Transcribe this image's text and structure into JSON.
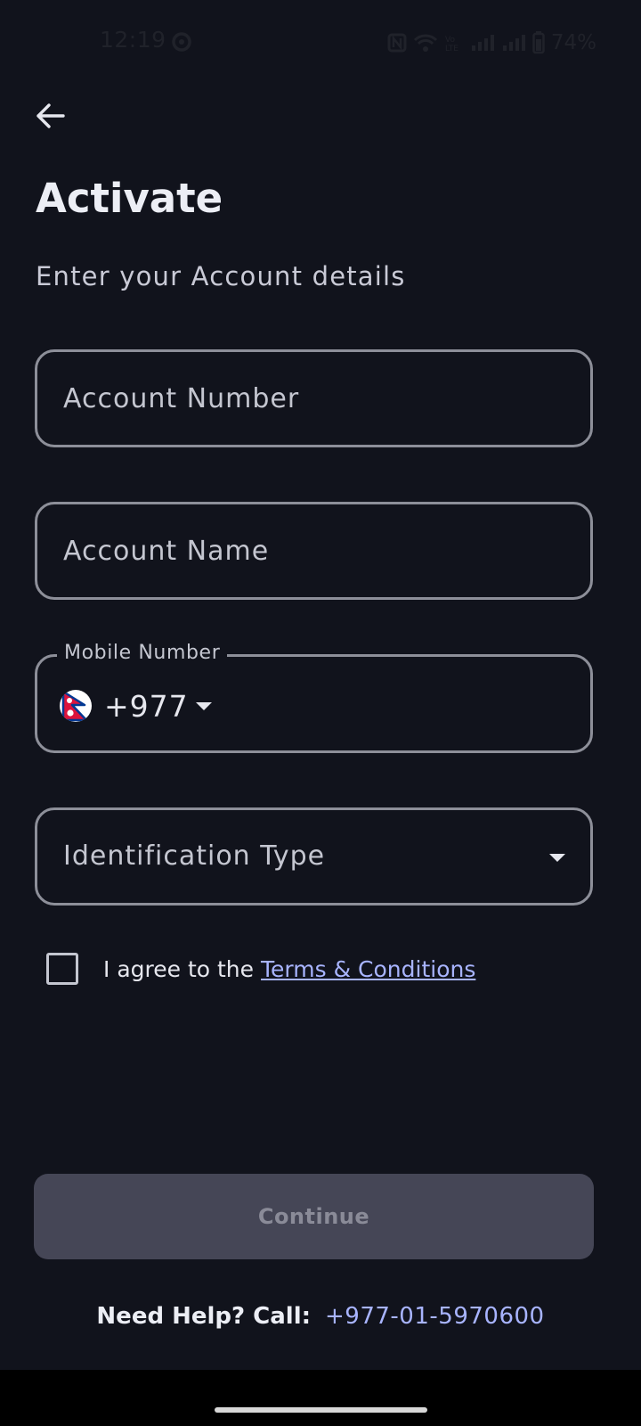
{
  "status_bar": {
    "time": "12:19",
    "battery": "74%",
    "icons": [
      "app-notification-icon",
      "nfc-icon",
      "wifi-icon",
      "volte-icon",
      "signal-icon",
      "signal-icon",
      "battery-icon"
    ]
  },
  "header": {
    "back_icon": "arrow-left-icon",
    "title": "Activate",
    "subtitle": "Enter your Account details"
  },
  "form": {
    "account_number": {
      "placeholder": "Account Number",
      "value": ""
    },
    "account_name": {
      "placeholder": "Account Name",
      "value": ""
    },
    "mobile_number": {
      "label": "Mobile Number",
      "country_flag": "nepal-flag-icon",
      "country_code": "+977",
      "value": ""
    },
    "identification_type": {
      "placeholder": "Identification Type",
      "icon": "chevron-down-icon"
    },
    "agree": {
      "checked": false,
      "text": "I agree to the",
      "link": "Terms & Conditions"
    }
  },
  "actions": {
    "continue_label": "Continue",
    "continue_enabled": false
  },
  "help": {
    "label": "Need Help? Call:",
    "phone": "+977-01-5970600"
  },
  "colors": {
    "background": "#11131c",
    "link": "#a8b4ff",
    "button_disabled_bg": "#454656",
    "button_disabled_text": "#8a8b98",
    "field_border": "#8d8f99"
  }
}
